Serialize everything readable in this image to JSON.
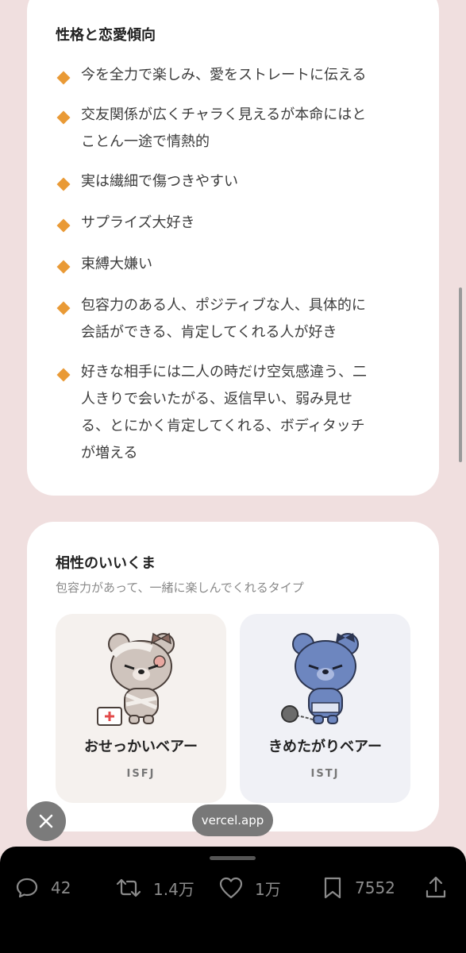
{
  "traits_section": {
    "title": "性格と恋愛傾向",
    "items": [
      {
        "lines": [
          "今を全力で楽しみ、愛をストレートに伝える"
        ]
      },
      {
        "lines": [
          "交友関係が広くチャラく見えるが本命にはと",
          "ことん一途で情熱的"
        ]
      },
      {
        "lines": [
          "実は繊細で傷つきやすい"
        ]
      },
      {
        "lines": [
          "サプライズ大好き"
        ]
      },
      {
        "lines": [
          "束縛大嫌い"
        ]
      },
      {
        "lines": [
          "包容力のある人、ポジティブな人、具体的に",
          "会話ができる、肯定してくれる人が好き"
        ]
      },
      {
        "lines": [
          "好きな相手には二人の時だけ空気感違う、二",
          "人きりで会いたがる、返信早い、弱み見せ",
          "る、とにかく肯定してくれる、ボディタッチ",
          "が増える"
        ]
      }
    ],
    "bullet_color": "#e99a36"
  },
  "compat_section": {
    "title": "相性のいいくま",
    "subtitle": "包容力があって、一緒に楽しんでくれるタイプ",
    "bears": [
      {
        "name": "おせっかいベアー",
        "type": "ISFJ",
        "icon": "beige-bear-with-bandages-and-first-aid-kit"
      },
      {
        "name": "きめたがりベアー",
        "type": "ISTJ",
        "icon": "blue-bear-with-ball-and-chain"
      }
    ]
  },
  "browser": {
    "domain": "vercel.app",
    "close_icon": "close-icon"
  },
  "actions": {
    "replies": "42",
    "retweets": "1.4万",
    "likes": "1万",
    "bookmarks": "7552"
  }
}
